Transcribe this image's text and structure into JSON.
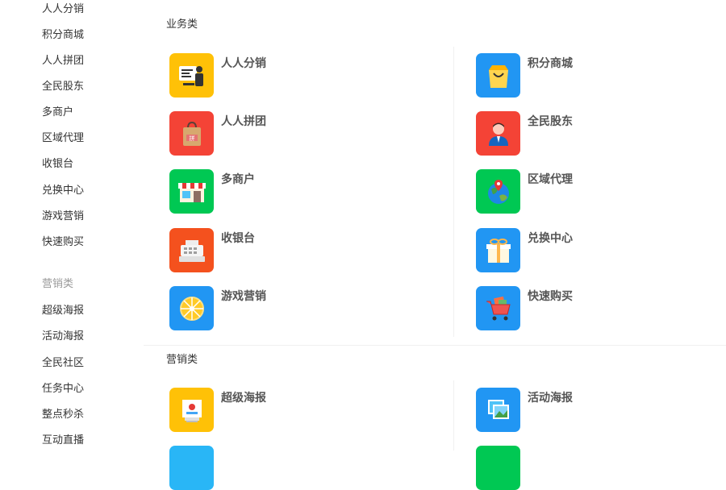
{
  "sidebar": {
    "items": [
      "人人分销",
      "积分商城",
      "人人拼团",
      "全民股东",
      "多商户",
      "区域代理",
      "收银台",
      "兑换中心",
      "游戏营销",
      "快速购买"
    ],
    "group_label": "营销类",
    "marketing_items": [
      "超级海报",
      "活动海报",
      "全民社区",
      "任务中心",
      "整点秒杀",
      "互动直播"
    ]
  },
  "main": {
    "business_title": "业务类",
    "marketing_title": "营销类",
    "business_apps": [
      {
        "label": "人人分销",
        "icon": "distribution-icon",
        "color": "#ffc107"
      },
      {
        "label": "积分商城",
        "icon": "shopping-bag-icon",
        "color": "#2196f3"
      },
      {
        "label": "人人拼团",
        "icon": "group-buy-bag-icon",
        "color": "#f44336"
      },
      {
        "label": "全民股东",
        "icon": "shareholder-avatar-icon",
        "color": "#f44336"
      },
      {
        "label": "多商户",
        "icon": "storefront-icon",
        "color": "#00c853"
      },
      {
        "label": "区域代理",
        "icon": "globe-pin-icon",
        "color": "#00c853"
      },
      {
        "label": "收银台",
        "icon": "cash-register-icon",
        "color": "#f4511e"
      },
      {
        "label": "兑换中心",
        "icon": "gift-box-icon",
        "color": "#2196f3"
      },
      {
        "label": "游戏营销",
        "icon": "lucky-wheel-icon",
        "color": "#2196f3"
      },
      {
        "label": "快速购买",
        "icon": "shopping-cart-icon",
        "color": "#2196f3"
      }
    ],
    "marketing_apps": [
      {
        "label": "超级海报",
        "icon": "poster-icon",
        "color": "#ffc107"
      },
      {
        "label": "活动海报",
        "icon": "photo-frame-icon",
        "color": "#2196f3"
      }
    ]
  }
}
